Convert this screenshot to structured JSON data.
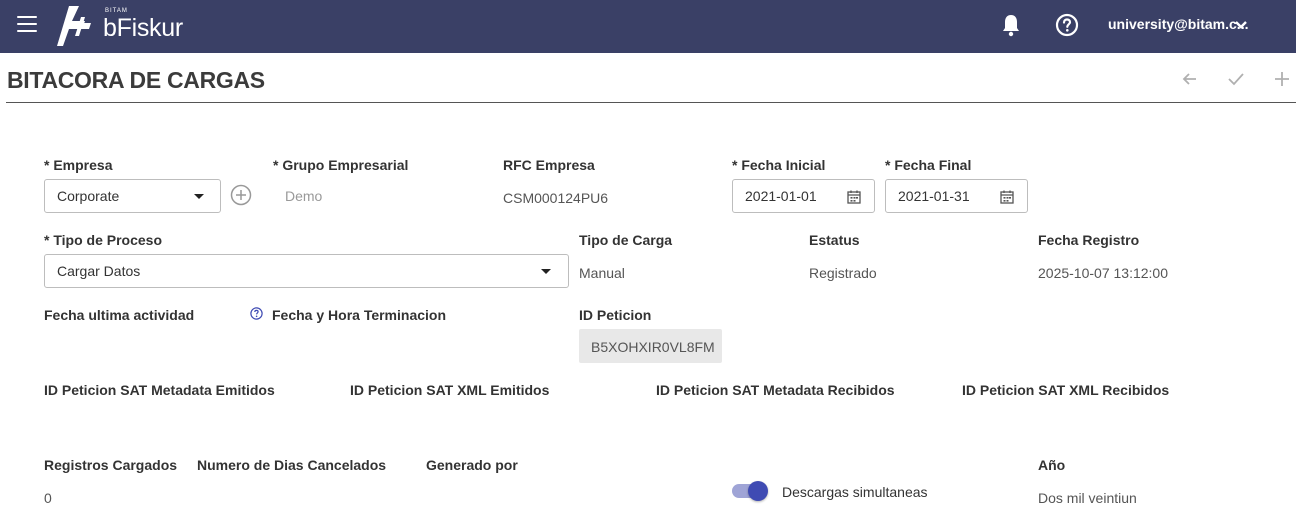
{
  "header": {
    "brand_small": "BITAM",
    "brand_name": "bFiskur",
    "user": "university@bitam.c...",
    "icons": [
      "menu-icon",
      "bell-icon",
      "help-icon",
      "chevron-down-icon"
    ]
  },
  "page": {
    "title": "BITACORA DE CARGAS",
    "toolbar_icons": [
      "arrow-left-icon",
      "check-icon",
      "plus-icon"
    ]
  },
  "form": {
    "empresa_label": "* Empresa",
    "empresa_value": "Corporate",
    "grupo_label": "* Grupo Empresarial",
    "grupo_value": "Demo",
    "rfc_label": "RFC Empresa",
    "rfc_value": "CSM000124PU6",
    "fecha_inicial_label": "* Fecha Inicial",
    "fecha_inicial_value": "2021-01-01",
    "fecha_final_label": "* Fecha Final",
    "fecha_final_value": "2021-01-31",
    "tipo_proceso_label": "* Tipo de Proceso",
    "tipo_proceso_value": "Cargar Datos",
    "tipo_carga_label": "Tipo de Carga",
    "tipo_carga_value": "Manual",
    "estatus_label": "Estatus",
    "estatus_value": "Registrado",
    "fecha_registro_label": "Fecha Registro",
    "fecha_registro_value": "2025-10-07 13:12:00",
    "fecha_ultima_label": "Fecha ultima actividad",
    "fecha_terminacion_label": "Fecha y Hora Terminacion",
    "id_peticion_label": "ID Peticion",
    "id_peticion_value": "B5XOHXIR0VL8FM",
    "sat_meta_emitidos_label": "ID Peticion SAT Metadata Emitidos",
    "sat_xml_emitidos_label": "ID Peticion SAT XML Emitidos",
    "sat_meta_recibidos_label": "ID Peticion SAT Metadata Recibidos",
    "sat_xml_recibidos_label": "ID Peticion SAT XML Recibidos",
    "registros_label": "Registros Cargados",
    "registros_value": "0",
    "dias_cancelados_label": "Numero de Dias Cancelados",
    "generado_label": "Generado por",
    "descargas_label": "Descargas simultaneas",
    "descargas_on": true,
    "anio_label": "Año",
    "anio_value": "Dos mil veintiun"
  },
  "colors": {
    "header_bg": "#3a4066",
    "toggle_track": "#9fa4d6",
    "toggle_knob": "#3f4bb3"
  }
}
